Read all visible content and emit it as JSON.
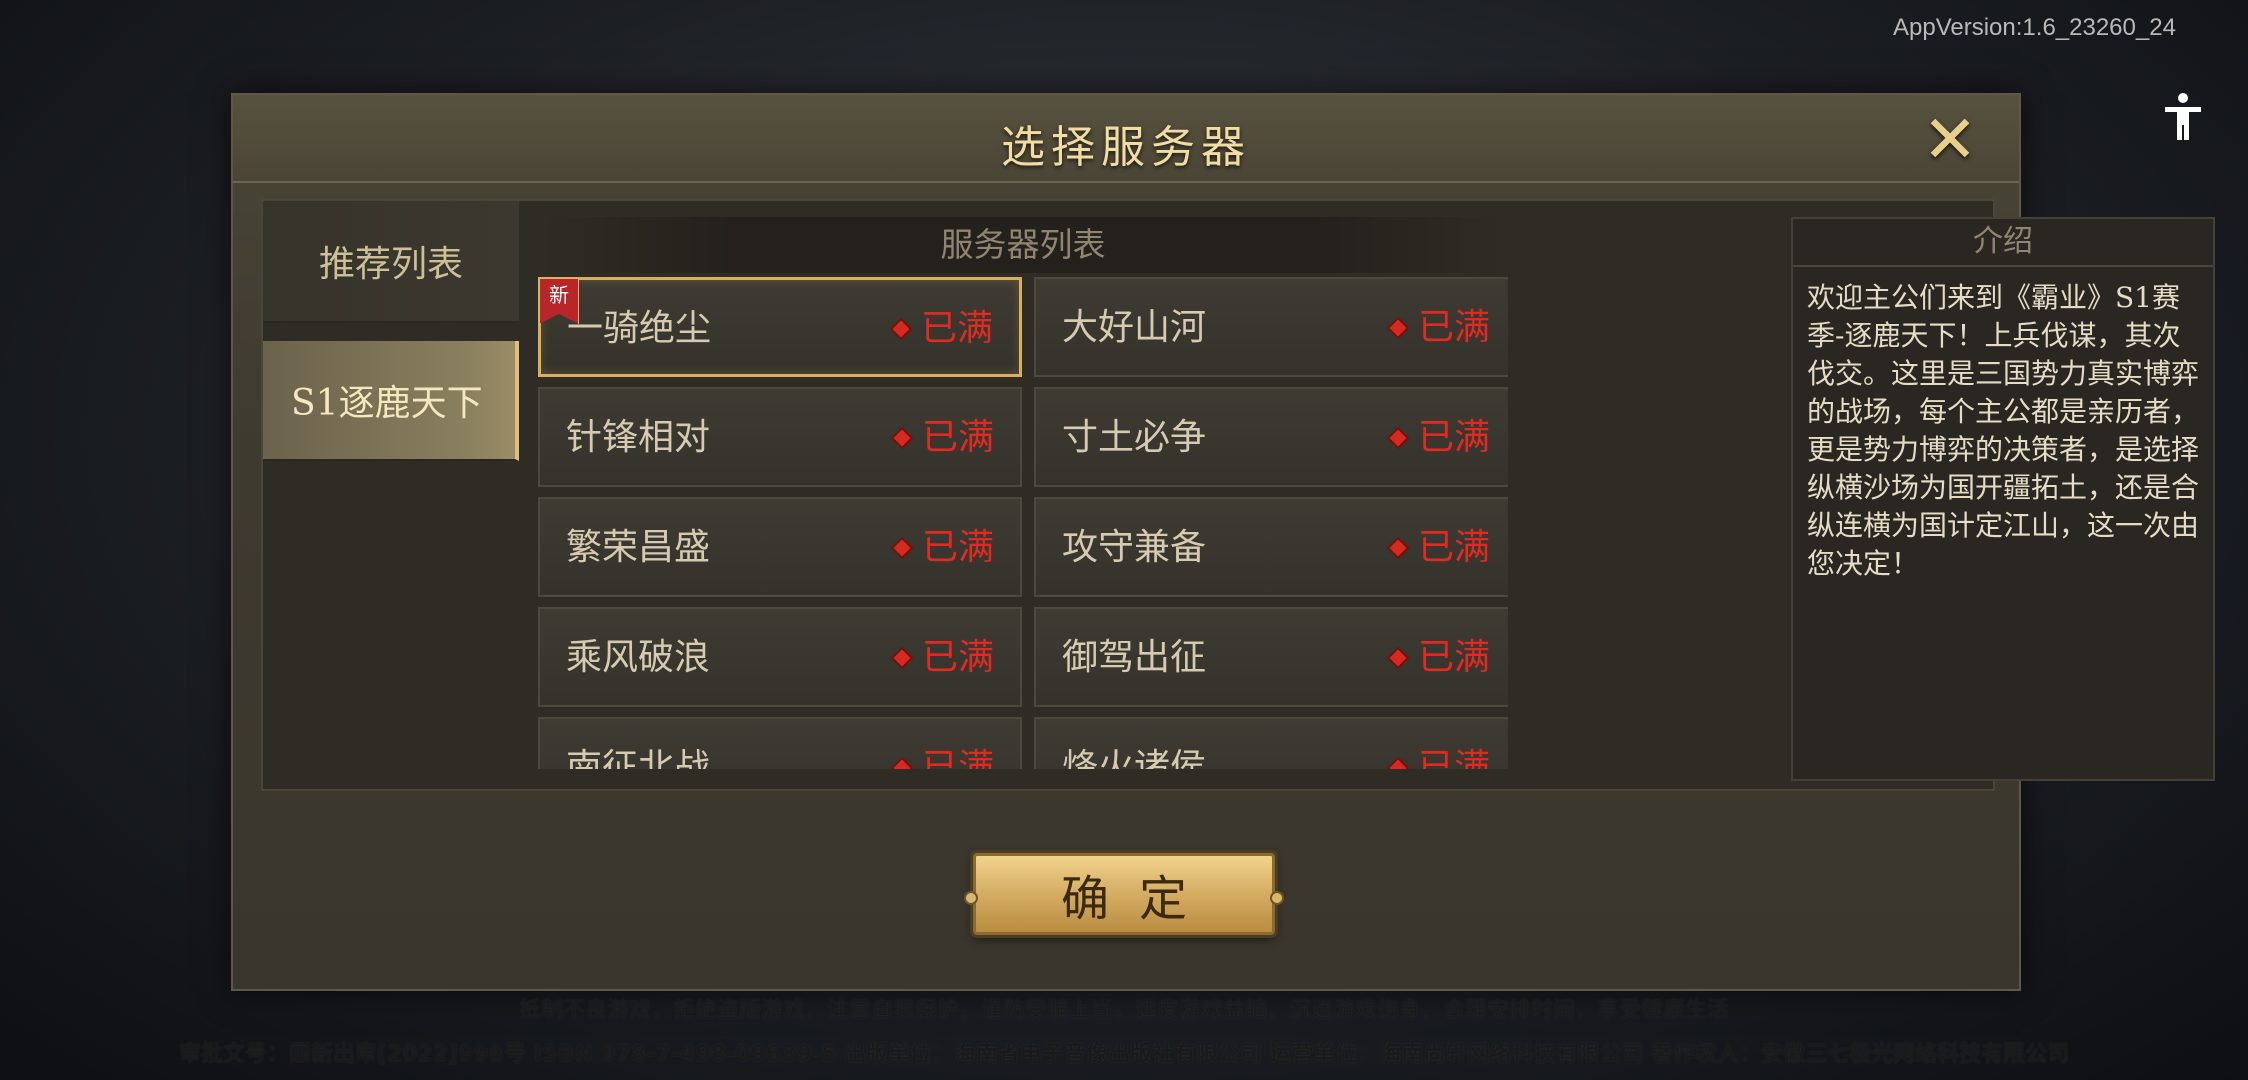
{
  "app_version": "AppVersion:1.6_23260_24",
  "dialog": {
    "title": "选择服务器",
    "close_icon": "close-icon"
  },
  "categories": [
    {
      "label": "推荐列表",
      "active": false
    },
    {
      "label": "S1逐鹿天下",
      "active": true
    }
  ],
  "server_list": {
    "header": "服务器列表",
    "new_badge": "新",
    "servers": [
      {
        "name": "一骑绝尘",
        "status": "已满",
        "is_new": true,
        "selected": true
      },
      {
        "name": "大好山河",
        "status": "已满",
        "is_new": false,
        "selected": false
      },
      {
        "name": "针锋相对",
        "status": "已满",
        "is_new": false,
        "selected": false
      },
      {
        "name": "寸土必争",
        "status": "已满",
        "is_new": false,
        "selected": false
      },
      {
        "name": "繁荣昌盛",
        "status": "已满",
        "is_new": false,
        "selected": false
      },
      {
        "name": "攻守兼备",
        "status": "已满",
        "is_new": false,
        "selected": false
      },
      {
        "name": "乘风破浪",
        "status": "已满",
        "is_new": false,
        "selected": false
      },
      {
        "name": "御驾出征",
        "status": "已满",
        "is_new": false,
        "selected": false
      },
      {
        "name": "南征北战",
        "status": "已满",
        "is_new": false,
        "selected": false
      },
      {
        "name": "烽火诸侯",
        "status": "已满",
        "is_new": false,
        "selected": false
      }
    ]
  },
  "intro": {
    "title": "介绍",
    "text": "欢迎主公们来到《霸业》S1赛季-逐鹿天下！上兵伐谋，其次伐交。这里是三国势力真实博弈的战场，每个主公都是亲历者，更是势力博弈的决策者，是选择纵横沙场为国开疆拓土，还是合纵连横为国计定江山，这一次由您决定！"
  },
  "confirm_label": "确定",
  "footer": {
    "line1": "抵制不良游戏，拒绝盗版游戏，注意自我保护，谨防受骗上当，适度游戏益脑，沉迷游戏伤身，合理安排时间，享受健康生活",
    "line2": "审批文号：国新出审[2022]998号 ISBN 978-7-498-09639-5 出版单位：海南省电子音像出版社有限公司 运营单位：海南尚轩网络科技有限公司 著作权人：安徽三七极光网络科技有限公司"
  },
  "system_nav": {
    "icons": [
      "accessibility-icon",
      "back-icon",
      "home-icon",
      "menu-icon"
    ]
  },
  "colors": {
    "accent_gold": "#d9b05a",
    "status_red": "#e22a22",
    "title_gold": "#f1dca2"
  }
}
